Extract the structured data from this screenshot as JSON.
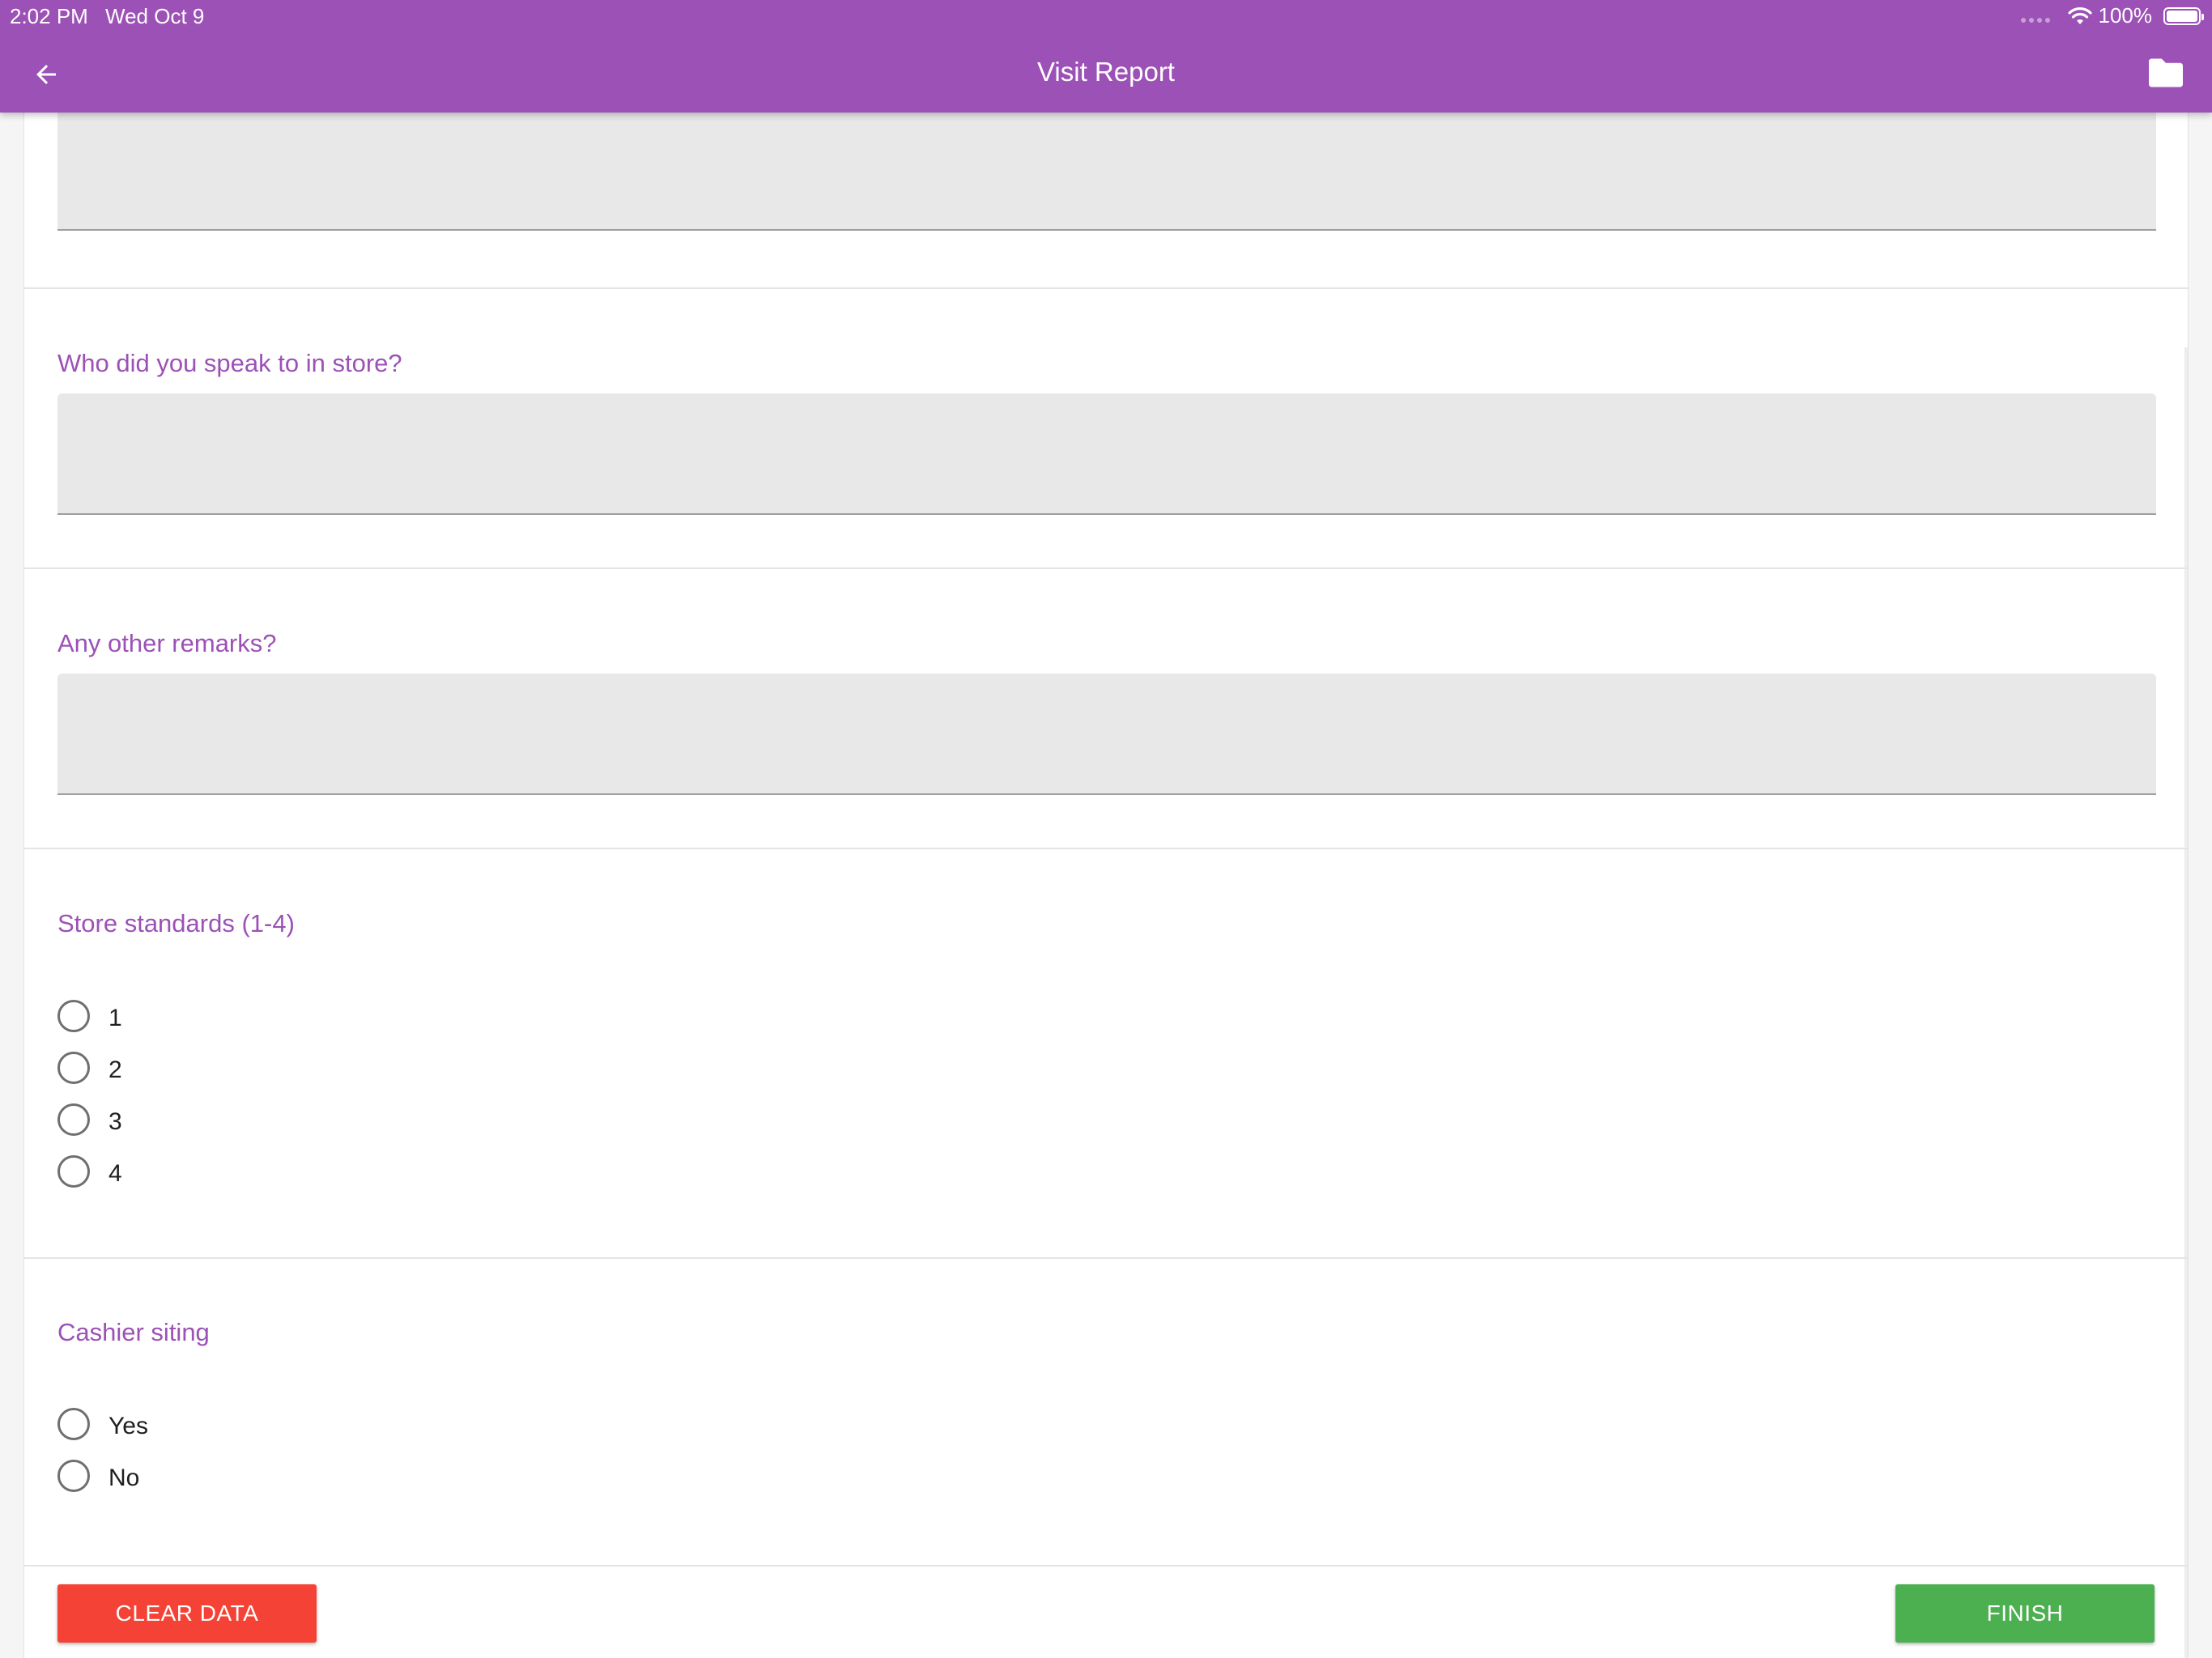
{
  "status_bar": {
    "time": "2:02 PM",
    "date": "Wed Oct 9",
    "battery": "100%"
  },
  "app_bar": {
    "title": "Visit Report",
    "back_icon": "arrow-left-icon",
    "folder_icon": "folder-icon"
  },
  "form": {
    "previous_answer": {
      "value": ""
    },
    "spoke_to": {
      "question": "Who did you speak to in store?",
      "value": ""
    },
    "remarks": {
      "question": "Any other remarks?",
      "value": ""
    },
    "store_standards": {
      "question": "Store standards (1-4)",
      "options": [
        "1",
        "2",
        "3",
        "4"
      ],
      "selected": null
    },
    "cashier_siting": {
      "question": "Cashier siting",
      "options": [
        "Yes",
        "No"
      ],
      "selected": null
    }
  },
  "footer": {
    "clear_label": "CLEAR DATA",
    "finish_label": "FINISH"
  },
  "colors": {
    "primary": "#9c51b6",
    "clear": "#f44336",
    "finish": "#4caf50",
    "input_bg": "#e8e8e8"
  }
}
